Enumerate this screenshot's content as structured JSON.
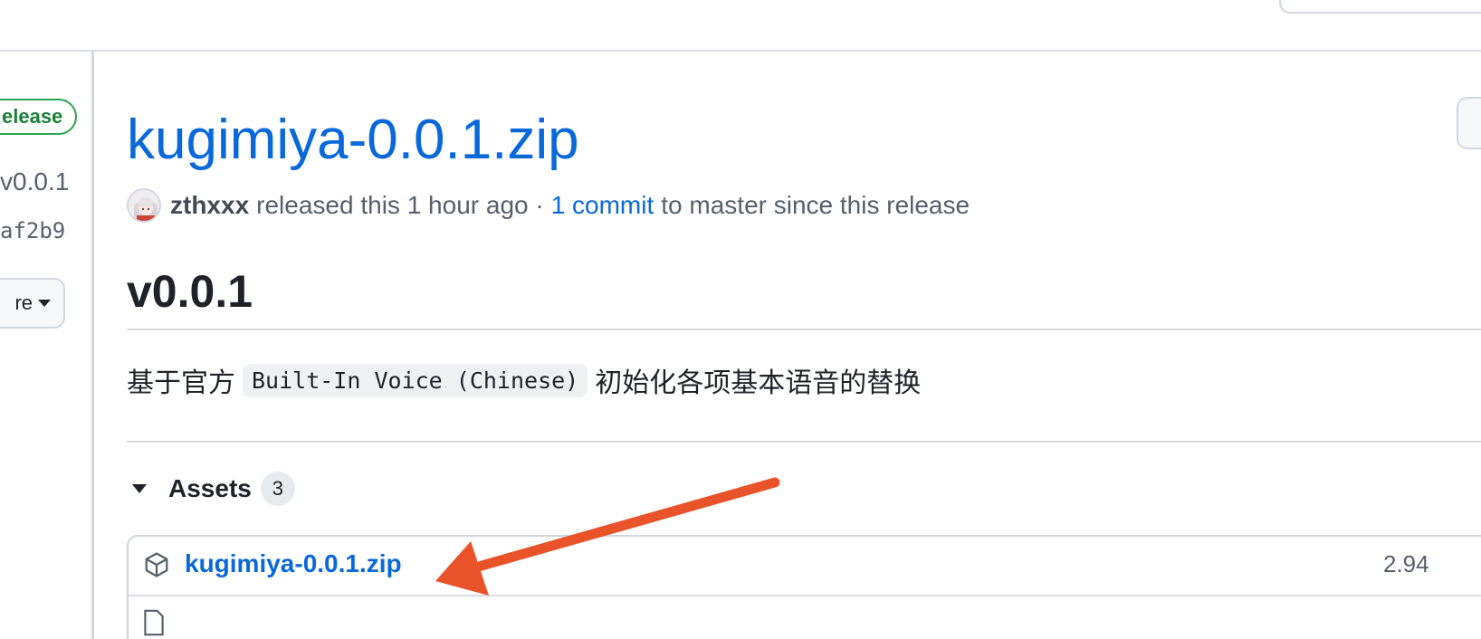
{
  "sidebar": {
    "latest_badge": "elease",
    "tag": "v0.0.1",
    "commit": "af2b9",
    "compare_label": "re"
  },
  "release": {
    "title": "kugimiya-0.0.1.zip",
    "author": "zthxxx",
    "released_text": "released this 1 hour ago ·",
    "commits_link": "1 commit",
    "commits_suffix": "to master since this release",
    "version_heading": "v0.0.1",
    "description_prefix": "基于官方",
    "description_code": "Built-In Voice (Chinese)",
    "description_suffix": "初始化各项基本语音的替换"
  },
  "assets": {
    "label": "Assets",
    "count": "3",
    "items": [
      {
        "name": "kugimiya-0.0.1.zip",
        "size": "2.94"
      }
    ]
  },
  "annotation": {
    "arrow_color": "#e8532a",
    "points_to": "kugimiya-0.0.1.zip"
  },
  "colors": {
    "link": "#0969da",
    "text": "#1f2328",
    "muted": "#57606a",
    "latest_green": "#1a7f37",
    "border": "#d0d7de"
  }
}
